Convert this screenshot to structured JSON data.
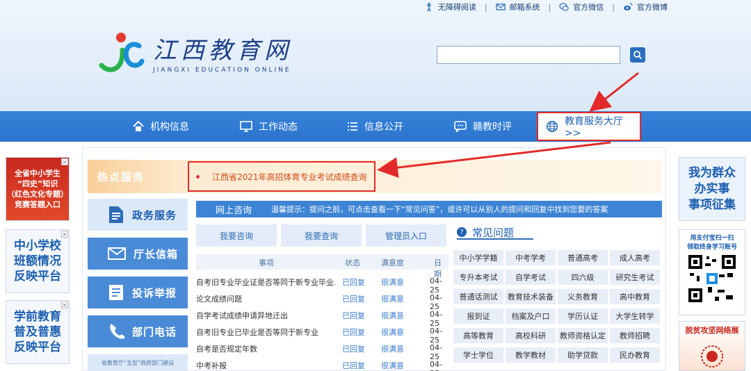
{
  "topbar": {
    "items": [
      {
        "label": "无障碍阅读",
        "icon": "accessibility-icon"
      },
      {
        "label": "邮箱系统",
        "icon": "mail-icon"
      },
      {
        "label": "官方微信",
        "icon": "wechat-icon"
      },
      {
        "label": "官方微博",
        "icon": "weibo-icon"
      }
    ]
  },
  "logo": {
    "cn": "江西教育网",
    "en": "JIANGXI EDUCATION ONLINE"
  },
  "search": {
    "value": ""
  },
  "nav": {
    "items": [
      {
        "label": "机构信息",
        "icon": "home-icon"
      },
      {
        "label": "工作动态",
        "icon": "monitor-icon"
      },
      {
        "label": "信息公开",
        "icon": "list-icon"
      },
      {
        "label": "赣教时评",
        "icon": "chat-icon"
      },
      {
        "label": "教育服务大厅>>",
        "icon": "globe-icon"
      }
    ]
  },
  "left_ads": [
    {
      "text": "全省中小学生\n“四史”知识\n（红色文化专题）\n竞赛答题入口"
    },
    {
      "text": "中小学校\n班额情况\n反映平台"
    },
    {
      "text": "学前教育\n普及普惠\n反映平台"
    }
  ],
  "right_ads": [
    {
      "text": "我为群众\n办实事\n事项征集"
    },
    {
      "text": "用支付宝扫一扫\n领取终身学习账号"
    },
    {
      "text": "脱贫攻坚网络展"
    }
  ],
  "hot": {
    "title": "热点服务",
    "link": "江西省2021年高招体育专业考试成绩查询"
  },
  "side_buttons": [
    {
      "label": "政务服务",
      "icon": "document-icon"
    },
    {
      "label": "厅长信箱",
      "icon": "envelope-icon"
    },
    {
      "label": "投诉举报",
      "icon": "report-icon"
    },
    {
      "label": "部门电话",
      "icon": "phone-icon"
    }
  ],
  "side_bottom": "省教育厅“五型”政府部门建设",
  "consult": {
    "title": "网上咨询",
    "tip": "温馨提示：提问之前，可点击查看一下“常见问答”，或许可以从别人的提问和回复中找到您要的答案",
    "tabs": [
      "我要咨询",
      "我要查询",
      "管理员入口"
    ],
    "headers": [
      "事项",
      "状态",
      "满意度",
      "日期"
    ],
    "rows": [
      {
        "q": "自考旧专业毕业证是否等同于新专业毕业...",
        "s": "已回复",
        "m": "很满意",
        "d": "04-25"
      },
      {
        "q": "论文成绩问题",
        "s": "已回复",
        "m": "很满意",
        "d": "04-25"
      },
      {
        "q": "自学考试成绩申请异地迁出",
        "s": "已回复",
        "m": "很满意",
        "d": "04-25"
      },
      {
        "q": "自考旧专业已毕业是否等同于新专业",
        "s": "已回复",
        "m": "很满意",
        "d": "04-25"
      },
      {
        "q": "自考是否规定年数",
        "s": "已回复",
        "m": "很满意",
        "d": "04-25"
      },
      {
        "q": "中考补报",
        "s": "已回复",
        "m": "很满意",
        "d": "04-25"
      }
    ]
  },
  "faq": {
    "title": "常见问题",
    "items": [
      "中小学学籍",
      "中考学考",
      "普通高考",
      "成人高考",
      "专升本考试",
      "自学考试",
      "四六级",
      "研究生考试",
      "普通话测试",
      "教育技术装备",
      "义务教育",
      "高中教育",
      "报到证",
      "档案及户口",
      "学历认证",
      "大学生转学",
      "高等教育",
      "高校科研",
      "教师资格认定",
      "教师招聘",
      "学士学位",
      "教学教材",
      "助学贷款",
      "民办教育"
    ]
  },
  "colors": {
    "nav": "#2c74cf",
    "accent": "#1d5fb0",
    "highlight": "#e32a2a",
    "ad_text": "#1d5fb0"
  }
}
